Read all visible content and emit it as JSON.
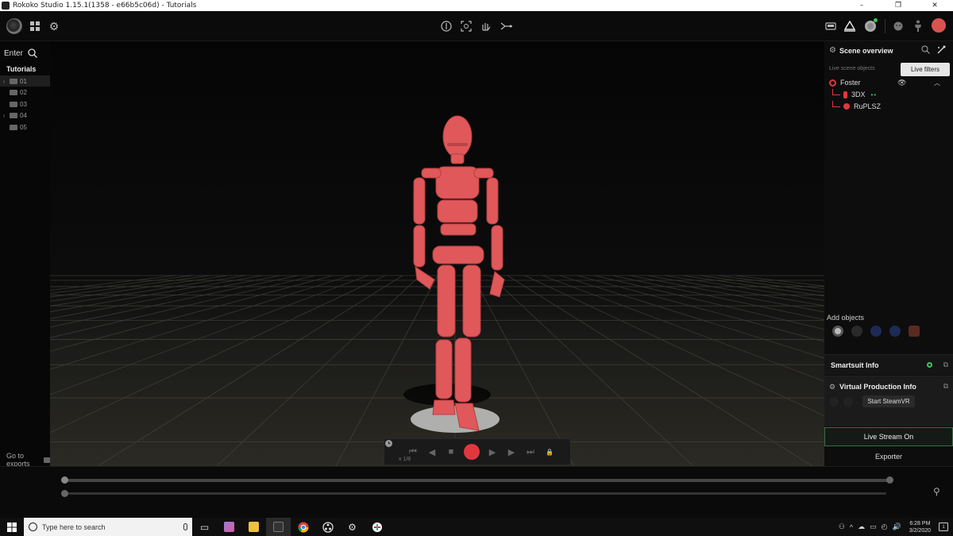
{
  "window": {
    "title": "Rokoko Studio 1.15.1(1358 - e66b5c06d) - Tutorials",
    "minimize": "–",
    "restore": "❐",
    "close": "✕"
  },
  "toolbar": {
    "left_icons": [
      "rokoko-logo-icon",
      "grid-icon",
      "gear-icon"
    ],
    "center_icons": [
      "body-icon",
      "face-capture-icon",
      "hand-icon",
      "export-arrow-icon"
    ],
    "right_icons": [
      "vr-headset-icon",
      "scene-icon",
      "recording-status-icon",
      "face-icon",
      "character-icon",
      "user-avatar-icon"
    ],
    "accent_color": "#e0383e",
    "status_color": "#3ec45c"
  },
  "left_panel": {
    "enter_label": "Enter",
    "tree_title": "Tutorials",
    "items": [
      {
        "label": "01",
        "expandable": true,
        "selected": true
      },
      {
        "label": "02",
        "expandable": false,
        "selected": false
      },
      {
        "label": "03",
        "expandable": false,
        "selected": false
      },
      {
        "label": "04",
        "expandable": true,
        "selected": false
      },
      {
        "label": "05",
        "expandable": false,
        "selected": false
      }
    ],
    "goto_exports": "Go to exports"
  },
  "player": {
    "speed": "x 1/8"
  },
  "scene_overview": {
    "title": "Scene overview",
    "tooltip": "Live filters",
    "live_label": "Live scene objects",
    "objects": [
      {
        "label": "Foster",
        "kind": "actor"
      },
      {
        "label": "3DX",
        "kind": "smartsuit"
      },
      {
        "label": "RuPLSZ",
        "kind": "glove"
      }
    ],
    "status_dots": "••"
  },
  "add_objects": {
    "label": "Add objects"
  },
  "smartsuit_info": {
    "title": "Smartsuit Info"
  },
  "virtual_production": {
    "title": "Virtual Production Info",
    "start_steamvr": "Start SteamVR"
  },
  "live_stream": "Live Stream On",
  "exporter": "Exporter",
  "taskbar": {
    "search_placeholder": "Type here to search",
    "time": "6:28 PM",
    "date": "3/2/2020",
    "notifications": "1"
  }
}
